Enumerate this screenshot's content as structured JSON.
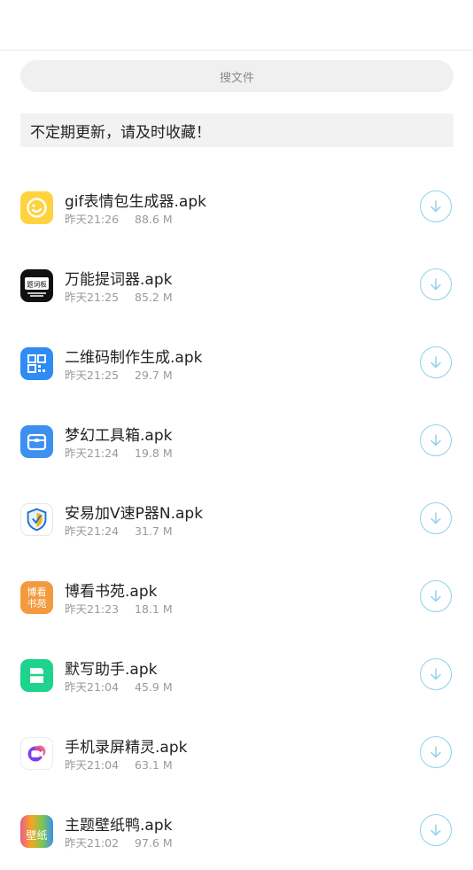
{
  "search": {
    "placeholder": "搜文件"
  },
  "notice": {
    "text": "不定期更新，请及时收藏！"
  },
  "files": [
    {
      "name": "gif表情包生成器.apk",
      "time": "昨天21:26",
      "size": "88.6 M",
      "icon": "gif-maker-icon",
      "icon_color": "#ffd23f"
    },
    {
      "name": "万能提词器.apk",
      "time": "昨天21:25",
      "size": "85.2 M",
      "icon": "teleprompter-icon",
      "icon_color": "#111111",
      "icon_text": "题词板"
    },
    {
      "name": "二维码制作生成.apk",
      "time": "昨天21:25",
      "size": "29.7 M",
      "icon": "qr-code-icon",
      "icon_color": "#2f8cf5"
    },
    {
      "name": "梦幻工具箱.apk",
      "time": "昨天21:24",
      "size": "19.8 M",
      "icon": "toolbox-icon",
      "icon_color": "#3d8ff0"
    },
    {
      "name": "安易加V速P器N.apk",
      "time": "昨天21:24",
      "size": "31.7 M",
      "icon": "shield-icon",
      "icon_color": "#ffffff"
    },
    {
      "name": "博看书苑.apk",
      "time": "昨天21:23",
      "size": "18.1 M",
      "icon": "bokan-book-icon",
      "icon_color": "#f49a3e",
      "icon_text": "博看书苑"
    },
    {
      "name": "默写助手.apk",
      "time": "昨天21:04",
      "size": "45.9 M",
      "icon": "dictation-icon",
      "icon_color": "#1ed38d"
    },
    {
      "name": "手机录屏精灵.apk",
      "time": "昨天21:04",
      "size": "63.1 M",
      "icon": "screen-recorder-icon",
      "icon_color": "#ffffff"
    },
    {
      "name": "主题壁纸鸭.apk",
      "time": "昨天21:02",
      "size": "97.6 M",
      "icon": "wallpaper-icon",
      "icon_color": "#e85c8a",
      "icon_text": "壁纸"
    }
  ],
  "colors": {
    "accent": "#8fd1ec",
    "meta_text": "#999999",
    "search_bg": "#f0f0f0"
  }
}
